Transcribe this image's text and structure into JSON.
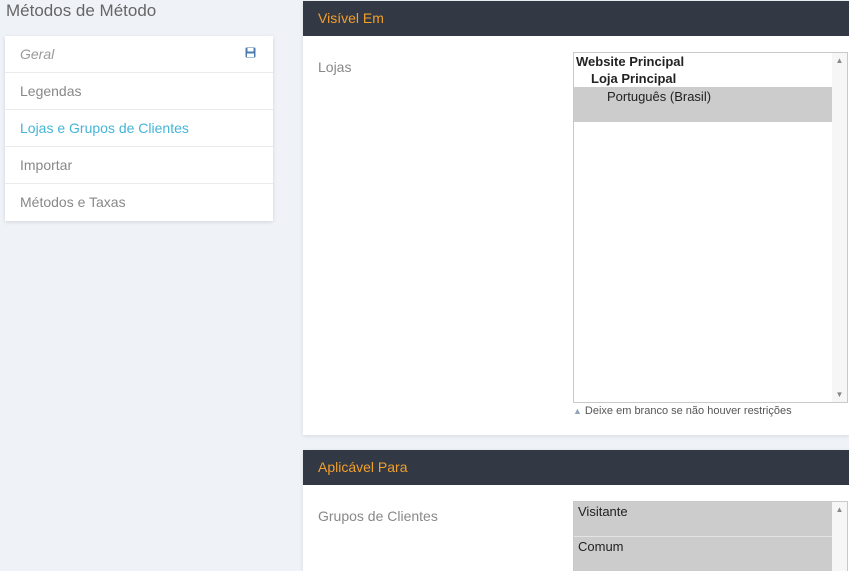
{
  "page": {
    "title": "Métodos de Método"
  },
  "sidebar": {
    "items": [
      {
        "label": "Geral"
      },
      {
        "label": "Legendas"
      },
      {
        "label": "Lojas e Grupos de Clientes"
      },
      {
        "label": "Importar"
      },
      {
        "label": "Métodos e Taxas"
      }
    ],
    "save_icon": "save-icon"
  },
  "visible_in": {
    "title": "Visível Em",
    "stores_label": "Lojas",
    "options": [
      {
        "label": "Website Principal"
      },
      {
        "label": "Loja Principal"
      },
      {
        "label": "Português (Brasil)"
      }
    ],
    "hint": "Deixe em branco se não houver restrições"
  },
  "applicable_to": {
    "title": "Aplicável Para",
    "groups_label": "Grupos de Clientes",
    "options": [
      {
        "label": "Visitante"
      },
      {
        "label": "Comum"
      }
    ]
  },
  "colors": {
    "accent_text": "#f29f2b",
    "panel_header_bg": "#323844",
    "active_link": "#45b5d8",
    "selected_option_bg": "#cccccc"
  }
}
